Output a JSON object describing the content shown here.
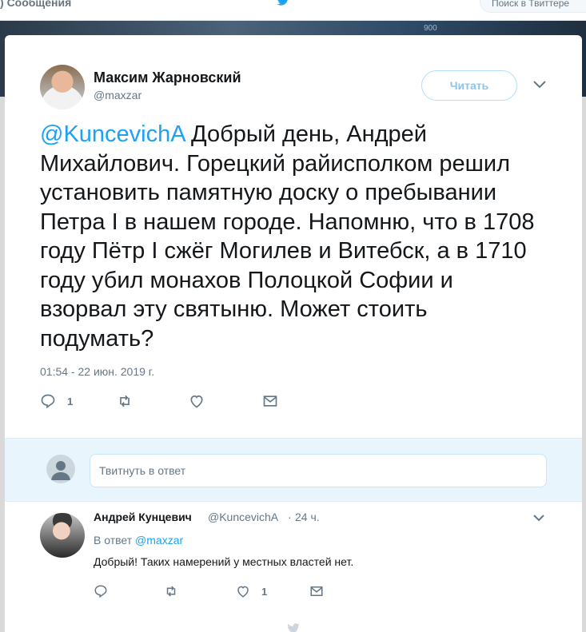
{
  "topbar": {
    "messages_label": "Сообщения",
    "search_placeholder": "Поиск в Твиттере"
  },
  "background": {
    "number": "900"
  },
  "tweet": {
    "author_name": "Максим Жарновский",
    "author_handle": "@maxzar",
    "follow_label": "Читать",
    "mention": "@KuncevichA",
    "body": " Добрый день, Андрей Михайлович. Горецкий райисполком решил установить памятную доску о пребывании Петра I в нашем городе. Напомню, что в 1708 году Пётр I сжёг Могилев и Витебск, а в 1710 году убил монахов Полоцкой Софии и взорвал эту святыню. Может стоить подумать?",
    "timestamp": "01:54 - 22 июн. 2019 г.",
    "reply_count": "1"
  },
  "reply_box": {
    "placeholder": "Твитнуть в ответ"
  },
  "reply": {
    "author_name": "Андрей Кунцевич",
    "author_handle": "@KuncevichA",
    "separator": "·",
    "time": "24 ч.",
    "in_reply_prefix": "В ответ",
    "in_reply_handle": "@maxzar",
    "text": "Добрый! Таких намерений у местных властей нет.",
    "like_count": "1"
  },
  "colors": {
    "accent": "#1da1f2",
    "text_primary": "#14171a",
    "text_secondary": "#657786",
    "reply_bg": "#e8f5fd"
  },
  "icons": [
    "twitter-bird-icon",
    "chevron-down-icon",
    "reply-icon",
    "retweet-icon",
    "like-icon",
    "direct-message-icon",
    "user-placeholder-icon"
  ]
}
